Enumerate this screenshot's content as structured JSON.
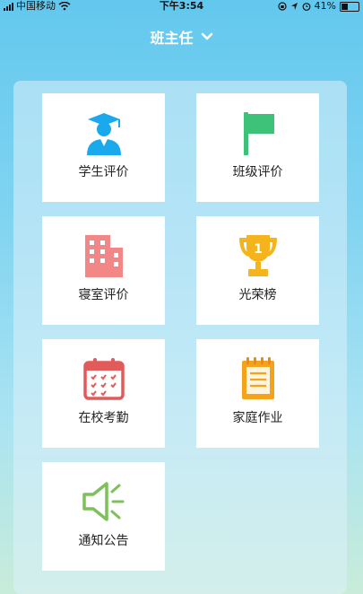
{
  "status_bar": {
    "carrier": "中国移动",
    "time": "下午3:54",
    "battery": "41%"
  },
  "header": {
    "title": "班主任"
  },
  "menu": [
    {
      "label": "学生评价",
      "icon": "student-graduate-icon"
    },
    {
      "label": "班级评价",
      "icon": "flag-icon"
    },
    {
      "label": "寝室评价",
      "icon": "dormitory-building-icon"
    },
    {
      "label": "光荣榜",
      "icon": "trophy-icon"
    },
    {
      "label": "在校考勤",
      "icon": "calendar-icon"
    },
    {
      "label": "家庭作业",
      "icon": "homework-notepad-icon"
    },
    {
      "label": "通知公告",
      "icon": "speaker-icon"
    }
  ],
  "colors": {
    "student": "#1aa9ec",
    "flag": "#3ec27a",
    "dorm": "#f38686",
    "trophy": "#f5b31c",
    "calendar": "#e15b5b",
    "notepad": "#f5a31c",
    "speaker": "#7ec05a"
  }
}
